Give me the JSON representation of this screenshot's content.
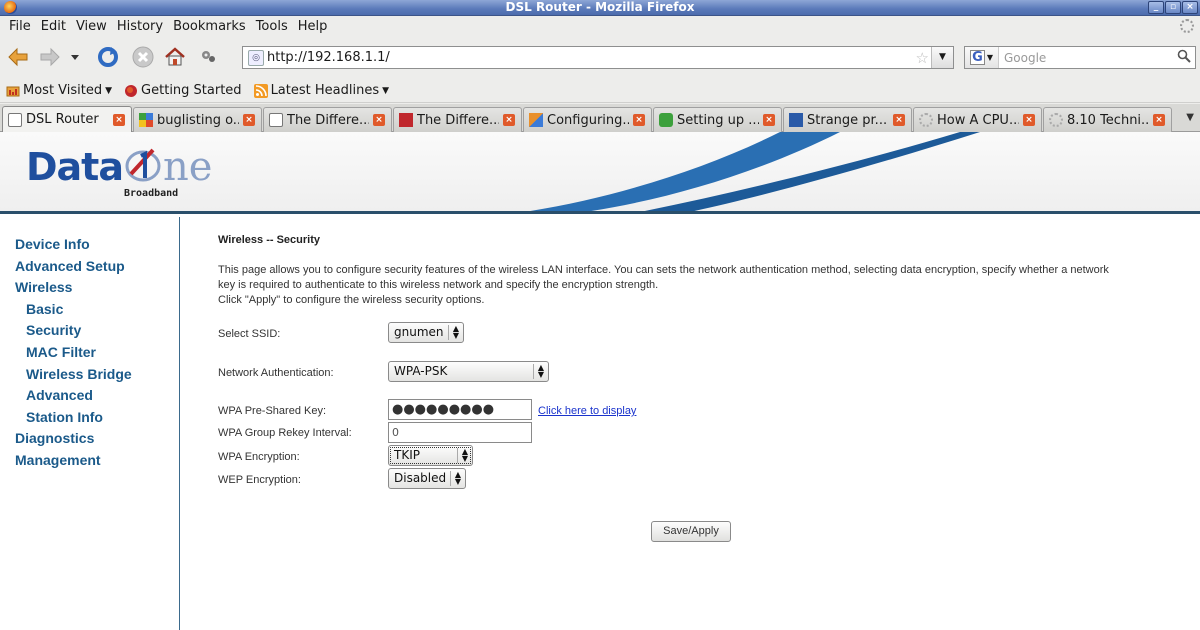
{
  "window": {
    "title": "DSL Router - Mozilla Firefox",
    "buttons": [
      "_",
      "▫",
      "×"
    ]
  },
  "menubar": {
    "items": [
      "File",
      "Edit",
      "View",
      "History",
      "Bookmarks",
      "Tools",
      "Help"
    ]
  },
  "navbar": {
    "url": "http://192.168.1.1/",
    "search_engine": "G",
    "search_placeholder": "Google"
  },
  "bookmarks": {
    "items": [
      "Most Visited",
      "Getting Started",
      "Latest Headlines"
    ]
  },
  "tabs": [
    {
      "title": "DSL Router",
      "icon_color": "#ffffff"
    },
    {
      "title": "buglisting o...",
      "icon_color": "#3b7bd8"
    },
    {
      "title": "The Differe...",
      "icon_color": "#ffffff"
    },
    {
      "title": "The Differe...",
      "icon_color": "#c0272d"
    },
    {
      "title": "Configuring...",
      "icon_color": "#e9902c"
    },
    {
      "title": "Setting up ...",
      "icon_color": "#3ca03c"
    },
    {
      "title": "Strange pr...",
      "icon_color": "#2a5aa8"
    },
    {
      "title": "How A CPU...",
      "icon_color": "#aaaaaa"
    },
    {
      "title": "8.10 Techni...",
      "icon_color": "#aaaaaa"
    }
  ],
  "banner": {
    "logo_data": "Data",
    "logo_one": "ne",
    "logo_sub": "Broadband"
  },
  "sidebar": {
    "items": [
      {
        "label": "Device Info",
        "level": 1
      },
      {
        "label": "Advanced Setup",
        "level": 1
      },
      {
        "label": "Wireless",
        "level": 1
      },
      {
        "label": "Basic",
        "level": 2
      },
      {
        "label": "Security",
        "level": 2
      },
      {
        "label": "MAC Filter",
        "level": 2
      },
      {
        "label": "Wireless Bridge",
        "level": 2
      },
      {
        "label": "Advanced",
        "level": 2
      },
      {
        "label": "Station Info",
        "level": 2
      },
      {
        "label": "Diagnostics",
        "level": 1
      },
      {
        "label": "Management",
        "level": 1
      }
    ]
  },
  "main": {
    "title": "Wireless -- Security",
    "desc_line1": "This page allows you to configure security features of the wireless LAN interface. You can sets the network authentication method, selecting data encryption, specify whether a network",
    "desc_line2": "key is required to authenticate to this wireless network and specify the encryption strength.",
    "desc_line3": "Click \"Apply\" to configure the wireless security options.",
    "ssid": {
      "label": "Select SSID:",
      "value": "gnumen"
    },
    "auth": {
      "label": "Network Authentication:",
      "value": "WPA-PSK"
    },
    "psk": {
      "label": "WPA Pre-Shared Key:",
      "value": "●●●●●●●●●",
      "link": "Click here to display"
    },
    "rekey": {
      "label": "WPA Group Rekey Interval:",
      "value": "0"
    },
    "wpa_enc": {
      "label": "WPA Encryption:",
      "value": "TKIP"
    },
    "wep_enc": {
      "label": "WEP Encryption:",
      "value": "Disabled"
    },
    "save_label": "Save/Apply"
  }
}
